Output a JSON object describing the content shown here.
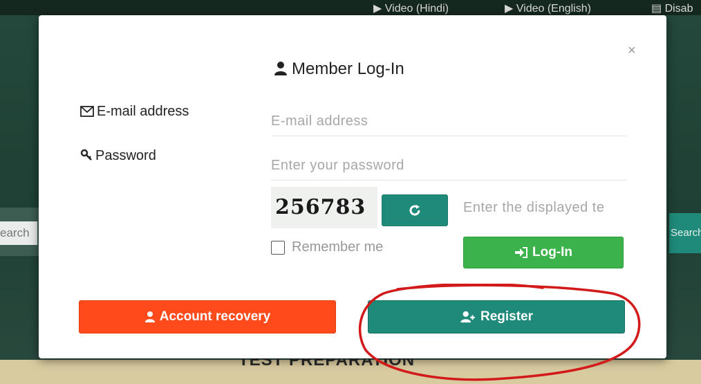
{
  "background": {
    "nav_items": [
      {
        "icon": "play-icon",
        "label": "Video (Hindi)"
      },
      {
        "icon": "play-icon",
        "label": "Video (English)"
      },
      {
        "icon": "document-icon",
        "label": "Disab"
      }
    ],
    "left_search_fragment": "earch",
    "right_search_fragment": "Search",
    "bottom_banner_text": "TEST PREPARATION"
  },
  "modal": {
    "title": "Member Log-In",
    "title_icon": "user-icon",
    "close_label": "×",
    "email": {
      "icon": "envelope-icon",
      "label": "E-mail address",
      "placeholder": "E-mail address",
      "value": ""
    },
    "password": {
      "icon": "key-icon",
      "label": "Password",
      "placeholder": "Enter your password",
      "value": ""
    },
    "captcha": {
      "code": "256783",
      "refresh_icon": "refresh-icon",
      "placeholder": "Enter the displayed te"
    },
    "remember_me": {
      "label": "Remember me",
      "checked": false
    },
    "login_button": {
      "icon": "sign-in-icon",
      "label": "Log-In"
    },
    "recovery_button": {
      "icon": "user-icon",
      "label": "Account recovery"
    },
    "register_button": {
      "icon": "user-plus-icon",
      "label": "Register"
    }
  },
  "colors": {
    "teal": "#1f8a7a",
    "green": "#3cb34a",
    "orange_red": "#ff4a1c",
    "annotation_red": "#d31a1a"
  }
}
